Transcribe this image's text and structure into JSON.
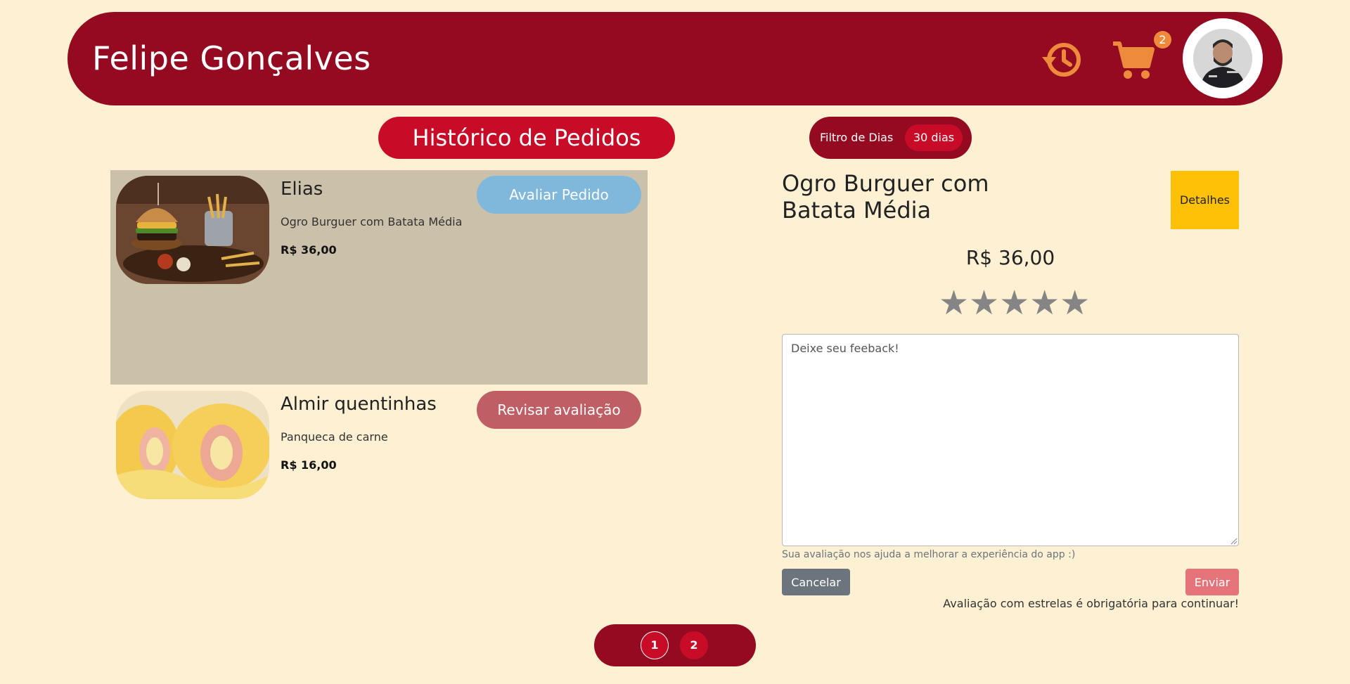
{
  "header": {
    "user_name": "Felipe Gonçalves",
    "cart_count": "2",
    "icons": [
      "history-icon",
      "cart-icon",
      "avatar"
    ],
    "brand_color": "#940a20",
    "accent_color": "#ee8a3b"
  },
  "page": {
    "title": "Histórico de Pedidos",
    "filter_label": "Filtro de Dias",
    "filter_value": "30 dias"
  },
  "orders": [
    {
      "restaurant": "Elias",
      "dish": "Ogro Burguer com Batata Média",
      "price": "R$ 36,00",
      "action": "Avaliar Pedido",
      "image": "burger-photo"
    },
    {
      "restaurant": "Almir quentinhas",
      "dish": "Panqueca de carne",
      "price": "R$ 16,00",
      "action": "Revisar avaliação",
      "image": "pancake-photo"
    }
  ],
  "detail": {
    "title": "Ogro Burguer com Batata Média",
    "details_button": "Detalhes",
    "price": "R$ 36,00",
    "stars_total": 5,
    "stars_selected": 0,
    "feedback_placeholder": "Deixe seu feeback!",
    "help_text": "Sua avaliação nos ajuda a melhorar a experiência do app :)",
    "cancel_label": "Cancelar",
    "submit_label": "Enviar",
    "required_note": "Avaliação com estrelas é obrigatória para continuar!"
  },
  "pagination": {
    "pages": [
      "1",
      "2"
    ],
    "current": "1"
  }
}
